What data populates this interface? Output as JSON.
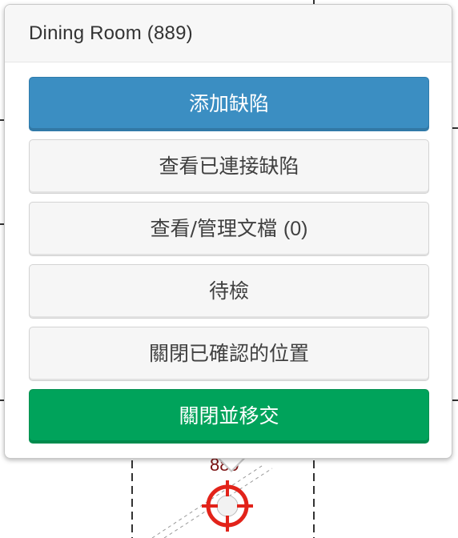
{
  "popover": {
    "title": "Dining Room (889)",
    "buttons": {
      "add_defect": "添加缺陷",
      "view_linked_defects": "查看已連接缺陷",
      "view_manage_docs": "查看/管理文檔",
      "docs_count": "(0)",
      "pending_inspection": "待檢",
      "close_confirmed_location": "關閉已確認的位置",
      "close_and_handover": "關閉並移交"
    }
  },
  "pin": {
    "label": "889",
    "icon": "crosshair-target-icon",
    "color": "#e2231a"
  },
  "colors": {
    "primary": "#3b8ec2",
    "success": "#00a35b",
    "default_bg": "#f6f6f6"
  }
}
